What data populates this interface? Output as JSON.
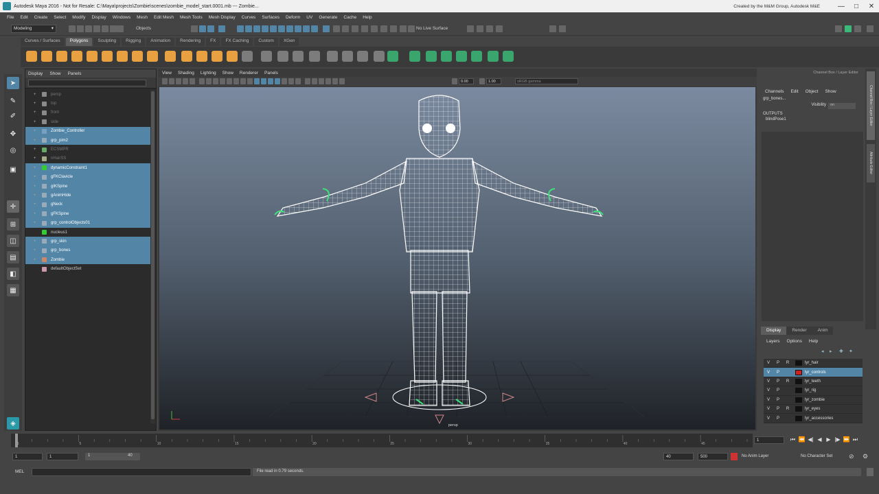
{
  "title_bar": {
    "title": "Autodesk Maya 2016 - Not for Resale: C:\\Maya\\projects\\Zombie\\scenes\\zombie_model_start.0001.mb --- Zombie...",
    "right_text": "Created by the M&M Group, Autodesk M&E",
    "minimize": "—",
    "maximize": "□",
    "close": "✕"
  },
  "menu_bar": [
    "File",
    "Edit",
    "Create",
    "Select",
    "Modify",
    "Display",
    "Windows",
    "Mesh",
    "Edit Mesh",
    "Mesh Tools",
    "Mesh Display",
    "Curves",
    "Surfaces",
    "Deform",
    "UV",
    "Generate",
    "Cache",
    "Help"
  ],
  "status_line": {
    "mode": "Modeling",
    "objects_label": "Objects",
    "no_live_surface": "No Live Surface"
  },
  "shelf_tabs": [
    {
      "label": "Curves / Surfaces",
      "active": false
    },
    {
      "label": "Polygons",
      "active": true
    },
    {
      "label": "Sculpting",
      "active": false
    },
    {
      "label": "Rigging",
      "active": false
    },
    {
      "label": "Animation",
      "active": false
    },
    {
      "label": "Rendering",
      "active": false
    },
    {
      "label": "FX",
      "active": false
    },
    {
      "label": "FX Caching",
      "active": false
    },
    {
      "label": "Custom",
      "active": false
    },
    {
      "label": "XGen",
      "active": false
    }
  ],
  "outliner": {
    "menu": [
      "Display",
      "Show",
      "Panels"
    ],
    "items": [
      {
        "label": "persp",
        "selected": false,
        "dim": true,
        "icon": "camera-icon",
        "color": "#8a8a8a"
      },
      {
        "label": "top",
        "selected": false,
        "dim": true,
        "icon": "camera-icon",
        "color": "#8a8a8a"
      },
      {
        "label": "front",
        "selected": false,
        "dim": true,
        "icon": "camera-icon",
        "color": "#8a8a8a"
      },
      {
        "label": "side",
        "selected": false,
        "dim": true,
        "icon": "camera-icon",
        "color": "#8a8a8a"
      },
      {
        "label": "Zombie_Controller",
        "selected": true,
        "dim": false,
        "icon": "curve-icon",
        "color": "#7aa0c0"
      },
      {
        "label": "grp_pim2",
        "selected": true,
        "dim": false,
        "icon": "group-icon",
        "color": "#9ab"
      },
      {
        "label": "ECSMPR",
        "selected": false,
        "dim": true,
        "icon": "mesh-icon",
        "color": "#6a6"
      },
      {
        "label": "nHairSS",
        "selected": false,
        "dim": true,
        "icon": "hair-icon",
        "color": "#aa8"
      },
      {
        "label": "dynamicConstraint1",
        "selected": true,
        "dim": false,
        "icon": "constraint-icon",
        "color": "#3c3"
      },
      {
        "label": "gFKClavicle",
        "selected": true,
        "dim": false,
        "icon": "group-icon",
        "color": "#9ab"
      },
      {
        "label": "gIKSpine",
        "selected": true,
        "dim": false,
        "icon": "group-icon",
        "color": "#9ab"
      },
      {
        "label": "gAnimHide",
        "selected": true,
        "dim": false,
        "icon": "group-icon",
        "color": "#9ab"
      },
      {
        "label": "gNeck",
        "selected": true,
        "dim": false,
        "icon": "group-icon",
        "color": "#9ab"
      },
      {
        "label": "gFKSpine",
        "selected": true,
        "dim": false,
        "icon": "group-icon",
        "color": "#9ab"
      },
      {
        "label": "grp_controlObjects01",
        "selected": true,
        "dim": false,
        "icon": "group-icon",
        "color": "#9ab"
      },
      {
        "label": "nucleus1",
        "selected": false,
        "dim": false,
        "icon": "nucleus-icon",
        "color": "#3c3"
      },
      {
        "label": "grp_skin",
        "selected": true,
        "dim": false,
        "icon": "group-icon",
        "color": "#9ab"
      },
      {
        "label": "grp_bones",
        "selected": true,
        "dim": false,
        "icon": "group-icon",
        "color": "#9ab"
      },
      {
        "label": "Zombie",
        "selected": true,
        "dim": false,
        "icon": "group-icon",
        "color": "#c86"
      },
      {
        "label": "defaultObjectSet",
        "selected": false,
        "dim": false,
        "icon": "set-icon",
        "color": "#c9a"
      }
    ]
  },
  "viewport": {
    "menu": [
      "View",
      "Shading",
      "Lighting",
      "Show",
      "Renderer",
      "Panels"
    ],
    "field_1": "0.00",
    "field_2": "1.00",
    "colorspace": "sRGB gamma",
    "camera_label": "persp"
  },
  "channel_box": {
    "title": "Channel Box / Layer Editor",
    "menu": [
      "Channels",
      "Edit",
      "Object",
      "Show"
    ],
    "object_name": "grp_bones...",
    "visibility_label": "Visibility",
    "visibility_value": "on",
    "outputs_label": "OUTPUTS",
    "output_item": "blindPose1"
  },
  "side_tabs": [
    "Channel Box / Layer Editor",
    "Attribute Editor"
  ],
  "layer_editor": {
    "tabs": [
      {
        "label": "Display",
        "active": true
      },
      {
        "label": "Render",
        "active": false
      },
      {
        "label": "Anim",
        "active": false
      }
    ],
    "menu": [
      "Layers",
      "Options",
      "Help"
    ],
    "layers": [
      {
        "v": "V",
        "p": "P",
        "r": "R",
        "color": "#111111",
        "name": "lyr_hair",
        "selected": false
      },
      {
        "v": "V",
        "p": "P",
        "r": "",
        "color": "#cc2222",
        "name": "lyr_controls",
        "selected": true
      },
      {
        "v": "V",
        "p": "P",
        "r": "R",
        "color": "#111111",
        "name": "lyr_teeth",
        "selected": false
      },
      {
        "v": "V",
        "p": "P",
        "r": "",
        "color": "#111111",
        "name": "lyr_rig",
        "selected": false
      },
      {
        "v": "V",
        "p": "P",
        "r": "",
        "color": "#111111",
        "name": "lyr_zombie",
        "selected": false
      },
      {
        "v": "V",
        "p": "P",
        "r": "R",
        "color": "#111111",
        "name": "lyr_eyes",
        "selected": false
      },
      {
        "v": "V",
        "p": "P",
        "r": "",
        "color": "#111111",
        "name": "lyr_accessories",
        "selected": false
      }
    ]
  },
  "time_slider": {
    "current_frame": "1",
    "tick_labels": [
      "1",
      "5",
      "10",
      "15",
      "20",
      "25",
      "30",
      "35",
      "40",
      "45"
    ]
  },
  "range_bar": {
    "start_frame": "1",
    "playback_start": "1",
    "slider_start": "1",
    "slider_end": "40",
    "playback_end": "40",
    "end_frame": "500",
    "anim_layer": "No Anim Layer",
    "character_set": "No Character Set"
  },
  "playback_controls": [
    "⏮",
    "⏪",
    "◀|",
    "◀",
    "▶",
    "|▶",
    "⏩",
    "⏭"
  ],
  "command_line": {
    "label": "MEL",
    "output": "File read in  0.79 seconds."
  },
  "colors": {
    "selection": "#5285a6",
    "panel_bg": "#444444",
    "shelf_orange": "#e8a040",
    "shelf_green": "#3cb878"
  }
}
